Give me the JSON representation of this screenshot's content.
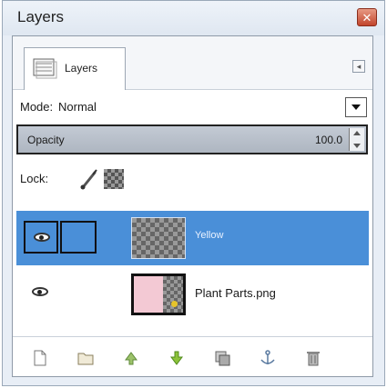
{
  "window": {
    "title": "Layers",
    "close_icon": "close-icon"
  },
  "tab": {
    "label": "Layers",
    "icon": "layers-stack-icon",
    "menu_icon": "tab-menu-icon"
  },
  "mode": {
    "label": "Mode:",
    "value": "Normal"
  },
  "opacity": {
    "label": "Opacity",
    "value": "100.0"
  },
  "lock": {
    "label": "Lock:",
    "icons": [
      "brush-icon",
      "alpha-checker-icon"
    ]
  },
  "layers": [
    {
      "name": "Yellow",
      "selected": true,
      "visible": true,
      "thumbnail": "transparent"
    },
    {
      "name": "Plant Parts.png",
      "selected": false,
      "visible": true,
      "thumbnail": "image"
    }
  ],
  "toolbar": {
    "buttons": [
      "new-layer-icon",
      "new-layer-group-icon",
      "raise-layer-icon",
      "lower-layer-icon",
      "duplicate-layer-icon",
      "anchor-layer-icon",
      "delete-layer-icon"
    ]
  },
  "colors": {
    "selection": "#4a8fd8",
    "window_bg": "#e8eef6",
    "close_button": "#c2452c"
  }
}
